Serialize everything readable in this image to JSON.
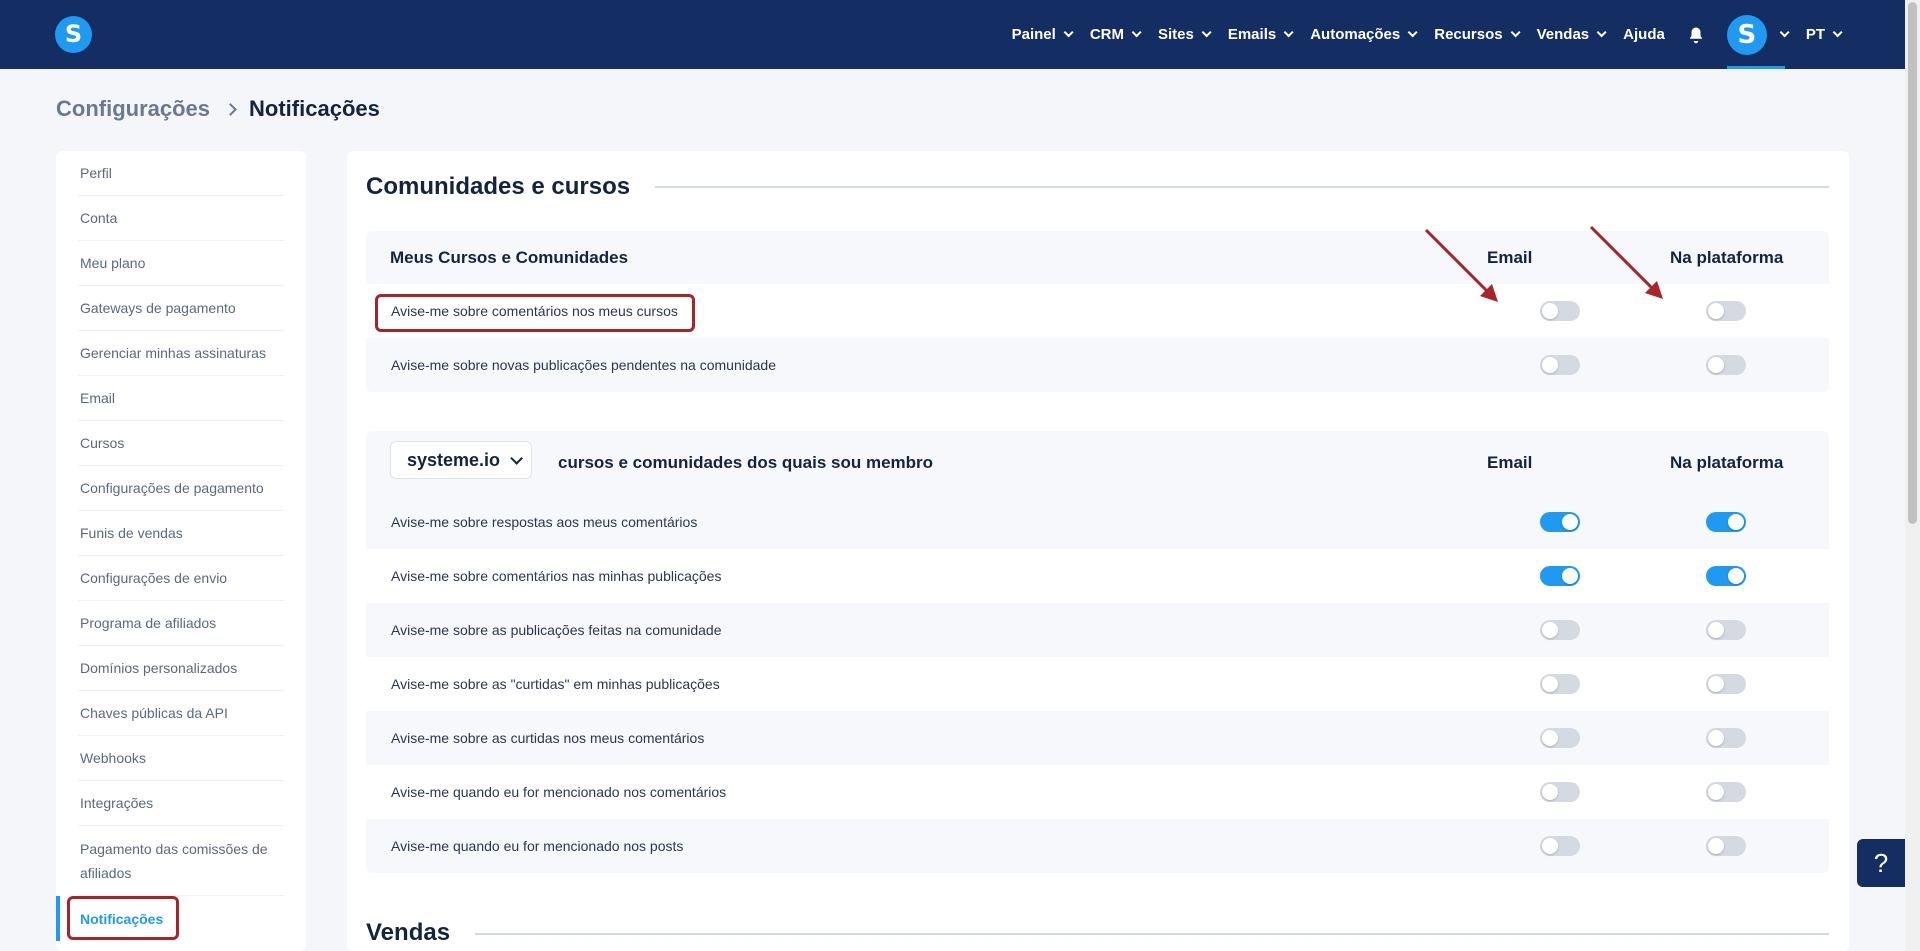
{
  "nav": {
    "items": [
      {
        "label": "Painel",
        "dropdown": true
      },
      {
        "label": "CRM",
        "dropdown": true
      },
      {
        "label": "Sites",
        "dropdown": true
      },
      {
        "label": "Emails",
        "dropdown": true
      },
      {
        "label": "Automações",
        "dropdown": true
      },
      {
        "label": "Recursos",
        "dropdown": true
      },
      {
        "label": "Vendas",
        "dropdown": true
      },
      {
        "label": "Ajuda",
        "dropdown": false
      }
    ],
    "logo_letter": "S",
    "avatar_letter": "S",
    "language": "PT"
  },
  "breadcrumb": {
    "parent": "Configurações",
    "current": "Notificações"
  },
  "sidebar": {
    "items": [
      "Perfil",
      "Conta",
      "Meu plano",
      "Gateways de pagamento",
      "Gerenciar minhas assinaturas",
      "Email",
      "Cursos",
      "Configurações de pagamento",
      "Funis de vendas",
      "Configurações de envio",
      "Programa de afiliados",
      "Domínios personalizados",
      "Chaves públicas da API",
      "Webhooks",
      "Integrações",
      "Pagamento das comissões de afiliados",
      "Notificações"
    ],
    "active": "Notificações"
  },
  "main": {
    "section1_title": "Comunidades e cursos",
    "card1": {
      "title": "Meus Cursos e Comunidades",
      "col_email": "Email",
      "col_platform": "Na plataforma",
      "rows": [
        {
          "label": "Avise-me sobre comentários nos meus cursos",
          "email": false,
          "platform": false
        },
        {
          "label": "Avise-me sobre novas publicações pendentes na comunidade",
          "email": false,
          "platform": false
        }
      ]
    },
    "card2": {
      "select_value": "systeme.io",
      "title": "cursos e comunidades dos quais sou membro",
      "col_email": "Email",
      "col_platform": "Na plataforma",
      "rows": [
        {
          "label": "Avise-me sobre respostas aos meus comentários",
          "email": true,
          "platform": true
        },
        {
          "label": "Avise-me sobre comentários nas minhas publicações",
          "email": true,
          "platform": true
        },
        {
          "label": "Avise-me sobre as publicações feitas na comunidade",
          "email": false,
          "platform": false
        },
        {
          "label": "Avise-me sobre as \"curtidas\" em minhas publicações",
          "email": false,
          "platform": false
        },
        {
          "label": "Avise-me sobre as curtidas nos meus comentários",
          "email": false,
          "platform": false
        },
        {
          "label": "Avise-me quando eu for mencionado nos comentários",
          "email": false,
          "platform": false
        },
        {
          "label": "Avise-me quando eu for mencionado nos posts",
          "email": false,
          "platform": false
        }
      ]
    },
    "section2_title": "Vendas"
  },
  "help_label": "?",
  "colors": {
    "navy": "#142d63",
    "accent": "#1f9af0",
    "highlight": "#a6242a"
  }
}
